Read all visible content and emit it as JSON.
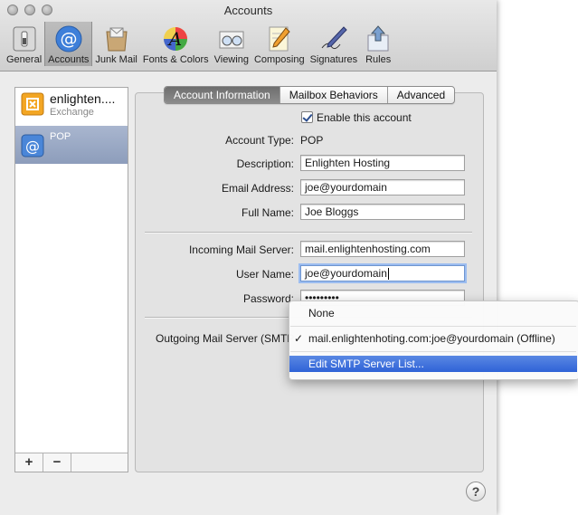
{
  "window": {
    "title": "Accounts"
  },
  "toolbar": {
    "items": [
      {
        "label": "General",
        "icon": "general-switch-icon"
      },
      {
        "label": "Accounts",
        "icon": "at-sign-icon",
        "active": true
      },
      {
        "label": "Junk Mail",
        "icon": "junk-mail-icon"
      },
      {
        "label": "Fonts & Colors",
        "icon": "fonts-colors-icon"
      },
      {
        "label": "Viewing",
        "icon": "viewing-glasses-icon"
      },
      {
        "label": "Composing",
        "icon": "composing-pencil-icon"
      },
      {
        "label": "Signatures",
        "icon": "signature-pen-icon"
      },
      {
        "label": "Rules",
        "icon": "rules-arrows-icon"
      }
    ]
  },
  "sidebar": {
    "accounts": [
      {
        "name": "enlighten....",
        "type": "Exchange",
        "icon": "exchange-icon"
      },
      {
        "name": "",
        "type": "POP",
        "icon": "at-sign-icon",
        "selected": true
      }
    ],
    "add_label": "+",
    "remove_label": "−"
  },
  "tabs": [
    "Account Information",
    "Mailbox Behaviors",
    "Advanced"
  ],
  "form": {
    "enable_label": "Enable this account",
    "enable_checked": true,
    "account_type_label": "Account Type:",
    "account_type_value": "POP",
    "description_label": "Description:",
    "description_value": "Enlighten Hosting",
    "email_label": "Email Address:",
    "email_value": "joe@yourdomain",
    "fullname_label": "Full Name:",
    "fullname_value": "Joe Bloggs",
    "incoming_label": "Incoming Mail Server:",
    "incoming_value": "mail.enlightenhosting.com",
    "username_label": "User Name:",
    "username_value": "joe@yourdomain",
    "password_label": "Password:",
    "password_value": "•••••••••",
    "outgoing_label": "Outgoing Mail Server (SMTP"
  },
  "smtp_menu": {
    "none_label": "None",
    "server_check": "✓",
    "server_label": "mail.enlightenhoting.com:joe@yourdomain (Offline)",
    "edit_label": "Edit SMTP Server List..."
  },
  "help_label": "?",
  "colors": {
    "accent": "#2f63d7",
    "selection": "#8d9dbb"
  }
}
